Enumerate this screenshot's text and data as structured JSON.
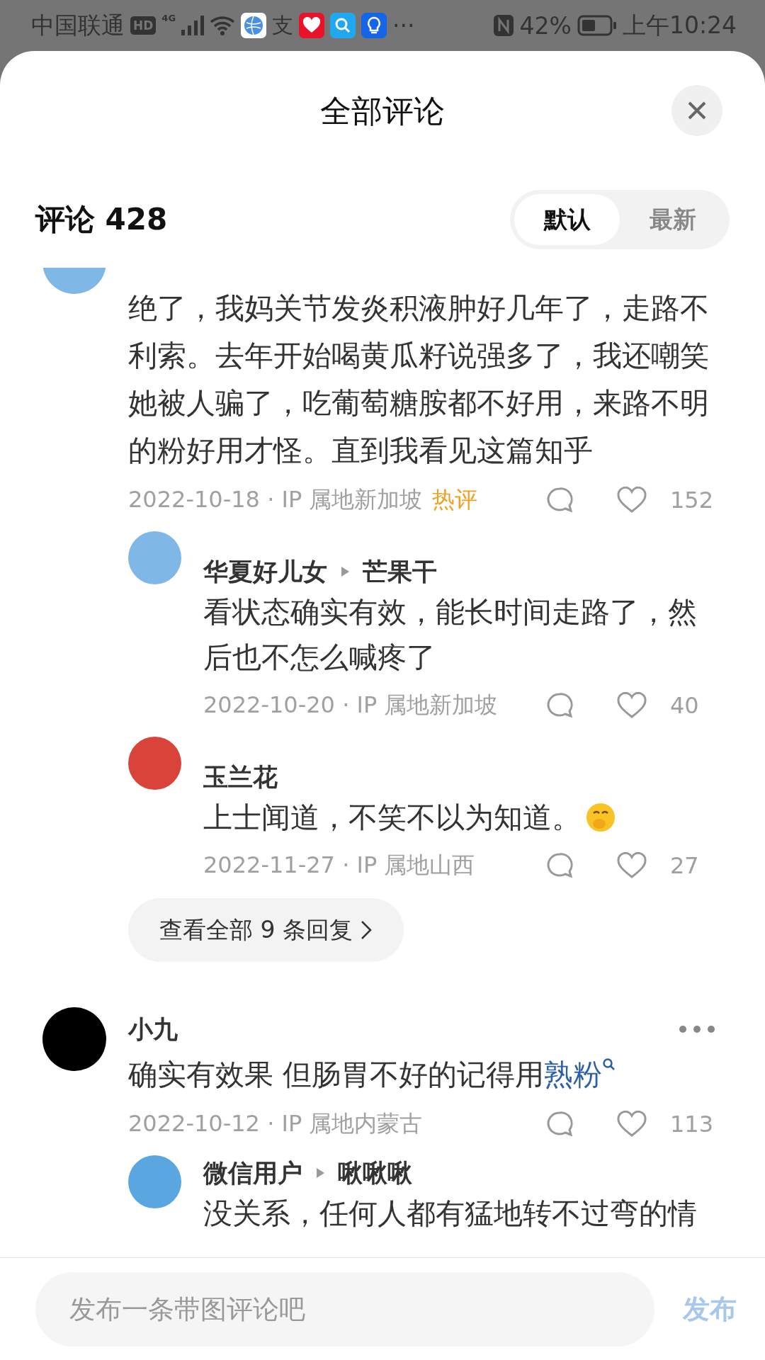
{
  "status_bar": {
    "carrier": "中国联通",
    "hd": "HD",
    "network": "4G",
    "app_glyph": "支",
    "more": "···",
    "battery": "42%",
    "time": "上午10:24"
  },
  "header": {
    "title": "全部评论"
  },
  "comments_header": {
    "label": "评论 428"
  },
  "sort_tabs": [
    {
      "label": "默认",
      "selected": true
    },
    {
      "label": "最新",
      "selected": false
    }
  ],
  "comments": [
    {
      "text": "绝了，我妈关节发炎积液肿好几年了，走路不利索。去年开始喝黄瓜籽说强多了，我还嘲笑她被人骗了，吃葡萄糖胺都不好用，来路不明的粉好用才怪。直到我看见这篇知乎",
      "meta": "2022-10-18 · IP 属地新加坡",
      "tag": "热评",
      "likes": "152",
      "color": "#7fb8e6",
      "replies": [
        {
          "author": "华夏好儿女",
          "reply_to": "芒果干",
          "text": "看状态确实有效，能长时间走路了，然后也不怎么喊疼了",
          "meta": "2022-10-20 · IP 属地新加坡",
          "likes": "40",
          "color": "#7fb8e6"
        },
        {
          "author": "玉兰花",
          "text": "上士闻道，不笑不以为知道。",
          "emoji": true,
          "meta": "2022-11-27 · IP 属地山西",
          "likes": "27",
          "color": "#d9443a"
        }
      ],
      "more_replies": "查看全部 9 条回复"
    },
    {
      "author": "小九",
      "text": "确实有效果 但肠胃不好的记得用",
      "link": "熟粉",
      "meta": "2022-10-12 · IP 属地内蒙古",
      "likes": "113",
      "color": "#000000",
      "replies": [
        {
          "author": "微信用户",
          "reply_to": "啾啾啾",
          "text": "没关系，任何人都有猛地转不过弯的情",
          "color": "#5aa6e0"
        }
      ]
    }
  ],
  "composer": {
    "placeholder": "发布一条带图评论吧",
    "submit": "发布"
  }
}
